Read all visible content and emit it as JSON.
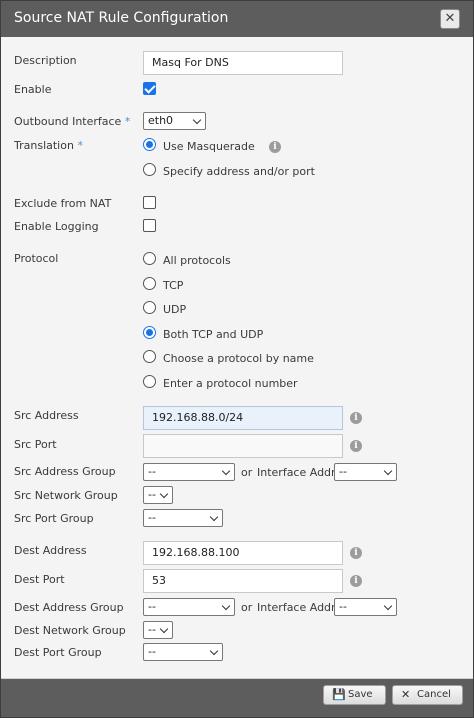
{
  "dialog": {
    "title": "Source NAT Rule Configuration",
    "close_glyph": "✕"
  },
  "description": {
    "label": "Description",
    "value": "Masq For DNS"
  },
  "enable": {
    "label": "Enable",
    "checked": true
  },
  "outbound_interface": {
    "label": "Outbound Interface",
    "required_mark": "*",
    "value": "eth0"
  },
  "translation": {
    "label": "Translation",
    "required_mark": "*",
    "options": [
      "Use Masquerade",
      "Specify address and/or port"
    ],
    "selected": "Use Masquerade"
  },
  "exclude_from_nat": {
    "label": "Exclude from NAT",
    "checked": false
  },
  "enable_logging": {
    "label": "Enable Logging",
    "checked": false
  },
  "protocol": {
    "label": "Protocol",
    "options": [
      "All protocols",
      "TCP",
      "UDP",
      "Both TCP and UDP",
      "Choose a protocol by name",
      "Enter a protocol number"
    ],
    "selected": "Both TCP and UDP"
  },
  "src": {
    "address_label": "Src Address",
    "address_value": "192.168.88.0/24",
    "port_label": "Src Port",
    "port_value": "",
    "address_group_label": "Src Address Group",
    "address_group_value": "--",
    "or_text": "or",
    "interface_addr_label": "Interface Addr",
    "interface_addr_value": "--",
    "network_group_label": "Src Network Group",
    "network_group_value": "--",
    "port_group_label": "Src Port Group",
    "port_group_value": "--"
  },
  "dest": {
    "address_label": "Dest Address",
    "address_value": "192.168.88.100",
    "port_label": "Dest Port",
    "port_value": "53",
    "address_group_label": "Dest Address Group",
    "address_group_value": "--",
    "or_text": "or",
    "interface_addr_label": "Interface Addr",
    "interface_addr_value": "--",
    "network_group_label": "Dest Network Group",
    "network_group_value": "--",
    "port_group_label": "Dest Port Group",
    "port_group_value": "--"
  },
  "footer": {
    "save_label": "Save",
    "cancel_label": "Cancel",
    "save_icon": "floppy-disk-icon",
    "cancel_icon": "x-icon"
  },
  "colors": {
    "accent": "#1a73e8",
    "titlebar": "#5d5d5d",
    "required": "#4a8fd6"
  }
}
